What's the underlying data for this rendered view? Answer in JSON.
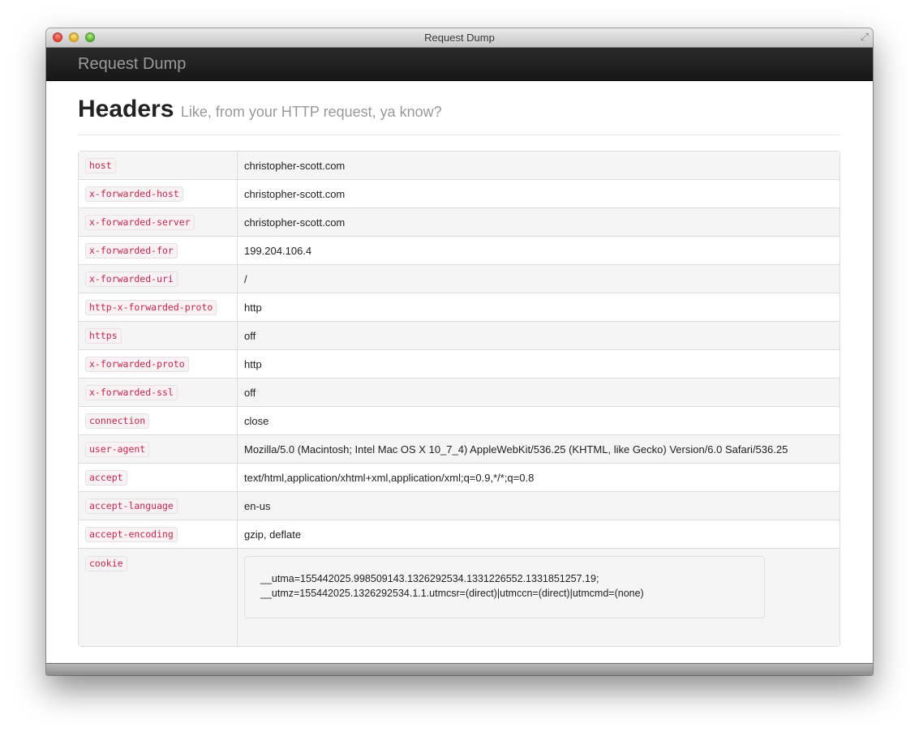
{
  "window": {
    "title": "Request Dump"
  },
  "navbar": {
    "brand": "Request Dump"
  },
  "page": {
    "title": "Headers",
    "subtitle": "Like, from your HTTP request, ya know?"
  },
  "headers": [
    {
      "key": "host",
      "value": "christopher-scott.com"
    },
    {
      "key": "x-forwarded-host",
      "value": "christopher-scott.com"
    },
    {
      "key": "x-forwarded-server",
      "value": "christopher-scott.com"
    },
    {
      "key": "x-forwarded-for",
      "value": "199.204.106.4"
    },
    {
      "key": "x-forwarded-uri",
      "value": "/"
    },
    {
      "key": "http-x-forwarded-proto",
      "value": "http"
    },
    {
      "key": "https",
      "value": "off"
    },
    {
      "key": "x-forwarded-proto",
      "value": "http"
    },
    {
      "key": "x-forwarded-ssl",
      "value": "off"
    },
    {
      "key": "connection",
      "value": "close"
    },
    {
      "key": "user-agent",
      "value": "Mozilla/5.0 (Macintosh; Intel Mac OS X 10_7_4) AppleWebKit/536.25 (KHTML, like Gecko) Version/6.0 Safari/536.25"
    },
    {
      "key": "accept",
      "value": "text/html,application/xhtml+xml,application/xml;q=0.9,*/*;q=0.8"
    },
    {
      "key": "accept-language",
      "value": "en-us"
    },
    {
      "key": "accept-encoding",
      "value": "gzip, deflate"
    }
  ],
  "cookie": {
    "key": "cookie",
    "lines": [
      "__utma=155442025.998509143.1326292534.1331226552.1331851257.19;",
      "__utmz=155442025.1326292534.1.1.utmcsr=(direct)|utmccn=(direct)|utmcmd=(none)"
    ]
  }
}
